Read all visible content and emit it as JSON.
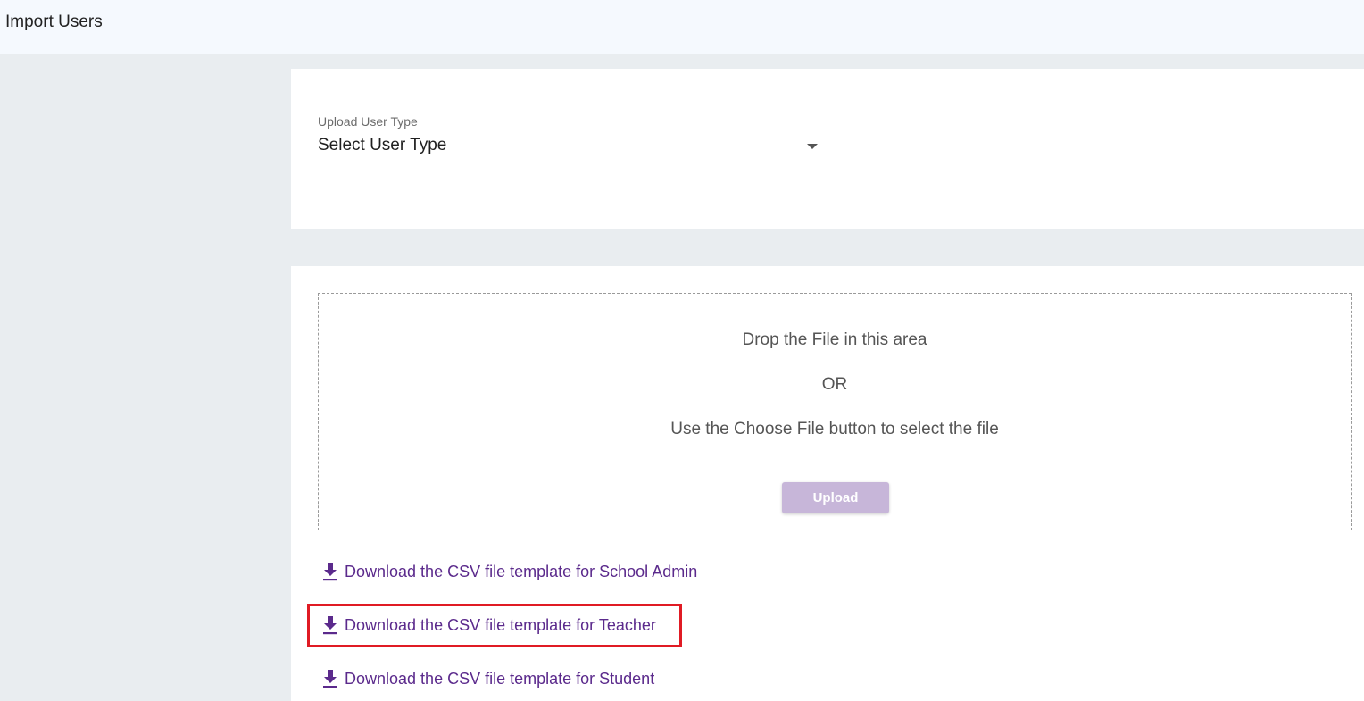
{
  "header": {
    "title": "Import Users"
  },
  "form": {
    "user_type_label": "Upload User Type",
    "user_type_value": "Select User Type"
  },
  "dropzone": {
    "line1": "Drop the File in this area",
    "line2": "OR",
    "line3": "Use the Choose File button to select the file",
    "upload_label": "Upload"
  },
  "downloads": [
    {
      "label": "Download the CSV file template for School Admin",
      "icon": "download-icon"
    },
    {
      "label": "Download the CSV file template for Teacher",
      "icon": "download-icon",
      "highlighted": true
    },
    {
      "label": "Download the CSV file template for Student",
      "icon": "download-icon"
    }
  ],
  "colors": {
    "accent": "#5b2a8c",
    "upload_disabled": "#c7b6d9",
    "highlight": "#e01b24",
    "background": "#e9edf0"
  }
}
